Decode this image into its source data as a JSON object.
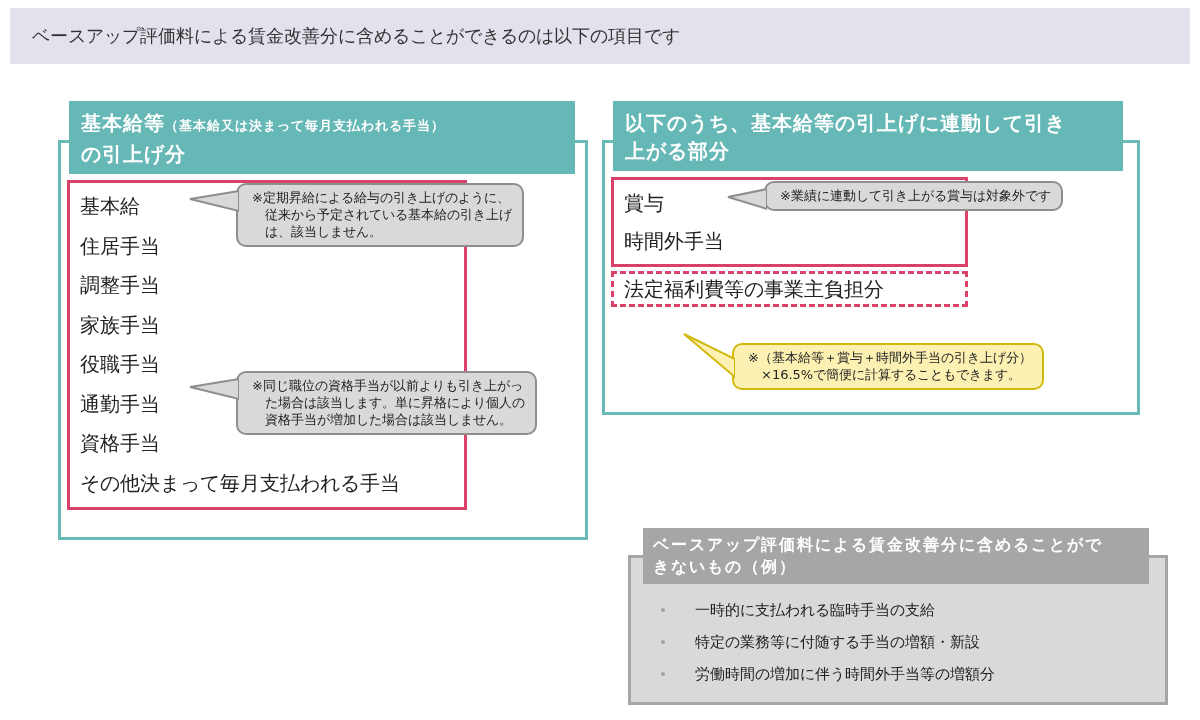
{
  "header": {
    "title": "ベースアップ評価料による賃金改善分に含めることができるのは以下の項目です"
  },
  "included_panel": {
    "title": {
      "main": "基本給等",
      "note": "（基本給又は決まって毎月支払われる手当）",
      "rest": "の引上げ分"
    },
    "items": [
      "基本給",
      "住居手当",
      "調整手当",
      "家族手当",
      "役職手当",
      "通勤手当",
      "資格手当",
      "その他決まって毎月支払われる手当"
    ],
    "callouts": [
      {
        "kind": "note",
        "lines": [
          "※定期昇給による給与の引き上げのように、",
          "従来から予定されている基本給の引き上げ",
          "は、該当しません。"
        ]
      },
      {
        "kind": "note",
        "lines": [
          "※同じ職位の資格手当が以前よりも引き上がっ",
          "た場合は該当します。単に昇格により個人の",
          "資格手当が増加した場合は該当しません。"
        ]
      }
    ]
  },
  "linked_panel": {
    "title": "以下のうち、基本給等の引上げに連動して引き上がる部分",
    "groups": [
      {
        "kind": "solid",
        "items": [
          "賞与",
          "時間外手当"
        ]
      },
      {
        "kind": "dashed",
        "items": [
          "法定福利費等の事業主負担分"
        ]
      }
    ],
    "callouts": [
      {
        "kind": "note",
        "lines": [
          "※業績に連動して引き上がる賞与は対象外です"
        ]
      },
      {
        "kind": "highlight",
        "lines": [
          "※（基本給等＋賞与＋時間外手当の引き上げ分）",
          "×16.5%で簡便に計算することもできます。"
        ]
      }
    ]
  },
  "excluded_panel": {
    "title": "ベースアップ評価料による賃金改善分に含めることができないもの（例）",
    "items": [
      "一時的に支払われる臨時手当の支給",
      "特定の業務等に付随する手当の増額・新設",
      "労働時間の増加に伴う時間外手当等の増額分"
    ]
  }
}
